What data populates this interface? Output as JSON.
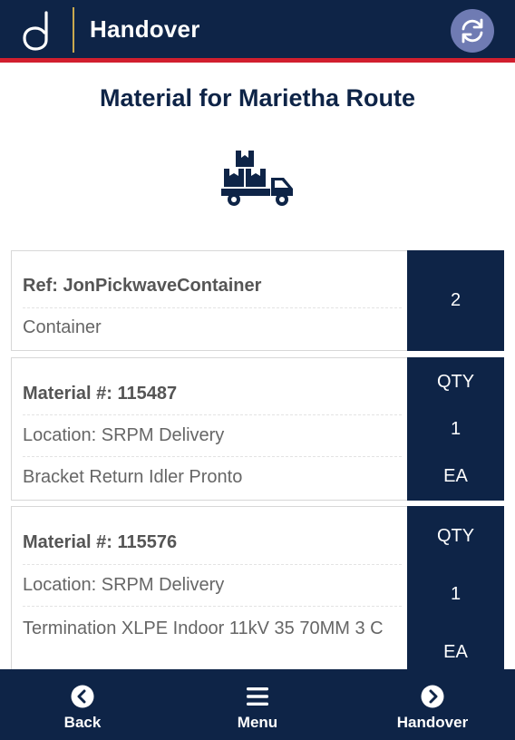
{
  "header": {
    "title": "Handover",
    "logo_letter": "d"
  },
  "page": {
    "title": "Material for Marietha Route"
  },
  "cards": [
    {
      "lines": [
        "Ref: JonPickwaveContainer",
        "Container"
      ],
      "qty_cells": [
        "2"
      ]
    },
    {
      "lines": [
        "Material #: 115487",
        "Location: SRPM Delivery",
        "Bracket Return Idler Pronto"
      ],
      "qty_cells": [
        "QTY",
        "1",
        "EA"
      ]
    },
    {
      "lines": [
        "Material #: 115576",
        "Location: SRPM Delivery",
        "Termination XLPE Indoor 11kV 35 70MM 3 C"
      ],
      "qty_cells": [
        "QTY",
        "1",
        "EA"
      ]
    }
  ],
  "bottom_nav": {
    "back": "Back",
    "menu": "Menu",
    "handover": "Handover"
  },
  "colors": {
    "navy": "#0e2447",
    "accent_red": "#d11f2e",
    "gold": "#c9a94f",
    "refresh_bg": "#6f7bb3"
  }
}
